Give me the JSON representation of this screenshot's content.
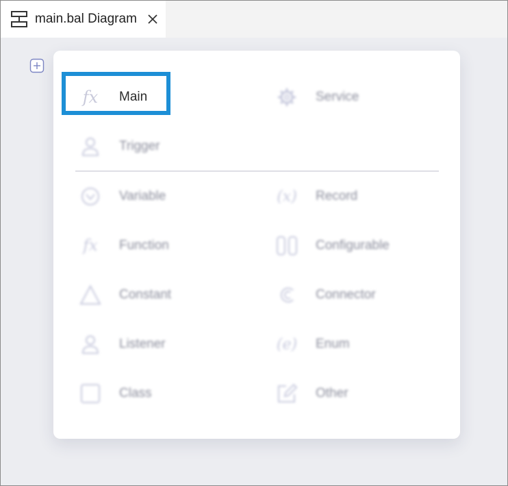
{
  "tab": {
    "title": "main.bal Diagram",
    "icon": "diagram-icon",
    "close_icon": "close-icon"
  },
  "canvas": {
    "add_icon": "plus-square-icon"
  },
  "menu": {
    "top_items": [
      {
        "label": "Main",
        "icon": "function-icon",
        "highlighted": true
      },
      {
        "label": "Service",
        "icon": "gear-icon"
      },
      {
        "label": "Trigger",
        "icon": "user-icon"
      }
    ],
    "items": [
      {
        "label": "Variable",
        "icon": "variable-icon"
      },
      {
        "label": "Record",
        "icon": "record-icon"
      },
      {
        "label": "Function",
        "icon": "function-icon"
      },
      {
        "label": "Configurable",
        "icon": "configurable-icon"
      },
      {
        "label": "Constant",
        "icon": "triangle-icon"
      },
      {
        "label": "Connector",
        "icon": "connector-icon"
      },
      {
        "label": "Listener",
        "icon": "user-icon"
      },
      {
        "label": "Enum",
        "icon": "enum-icon"
      },
      {
        "label": "Class",
        "icon": "square-icon"
      },
      {
        "label": "Other",
        "icon": "edit-icon"
      }
    ],
    "highlight_color": "#1d8fd6"
  }
}
